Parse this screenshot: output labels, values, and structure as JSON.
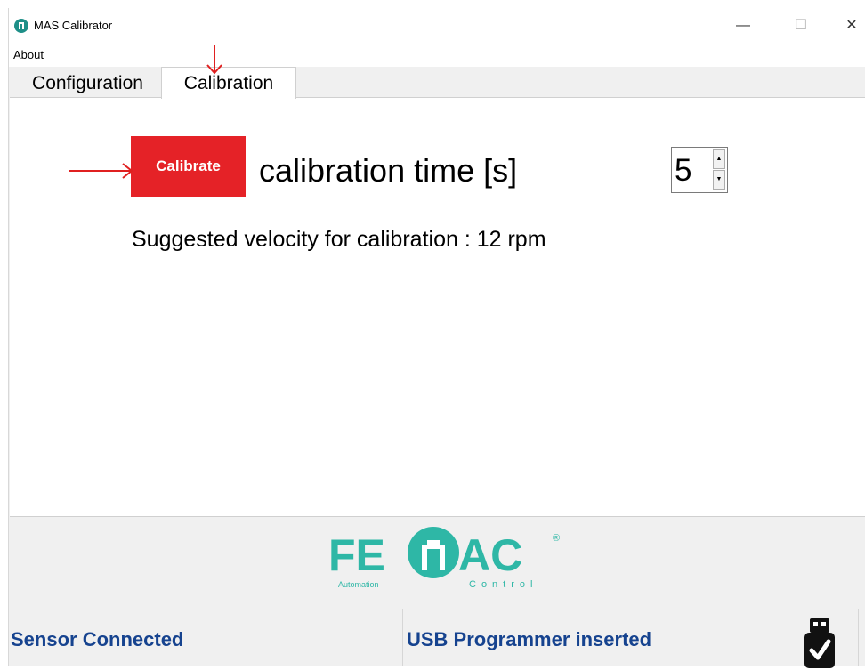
{
  "window": {
    "title": "MAS Calibrator",
    "minimize_glyph": "—",
    "maximize_glyph": "☐",
    "close_glyph": "✕"
  },
  "menu": {
    "about": "About"
  },
  "tabs": [
    {
      "label": "Configuration",
      "selected": false
    },
    {
      "label": "Calibration",
      "selected": true
    }
  ],
  "calibration": {
    "button_label": "Calibrate",
    "time_label": "calibration time [s]",
    "time_value": "5",
    "suggested_text": "Suggested velocity for calibration : 12 rpm"
  },
  "branding": {
    "logo_main_left": "FE",
    "logo_main_right": "AC",
    "logo_sub_left": "Automation",
    "logo_sub_right": "Control",
    "logo_registered": "®"
  },
  "status": {
    "sensor": "Sensor Connected",
    "usb": "USB Programmer inserted"
  },
  "colors": {
    "accent_red": "#e52227",
    "status_blue": "#16438f",
    "logo_teal": "#2eb7a6",
    "annotation_red": "#e02020"
  },
  "icons": {
    "app": "app-logo-icon",
    "usb": "usb-check-icon",
    "annotations": [
      "arrow-down-annotation",
      "arrow-right-annotation"
    ]
  }
}
